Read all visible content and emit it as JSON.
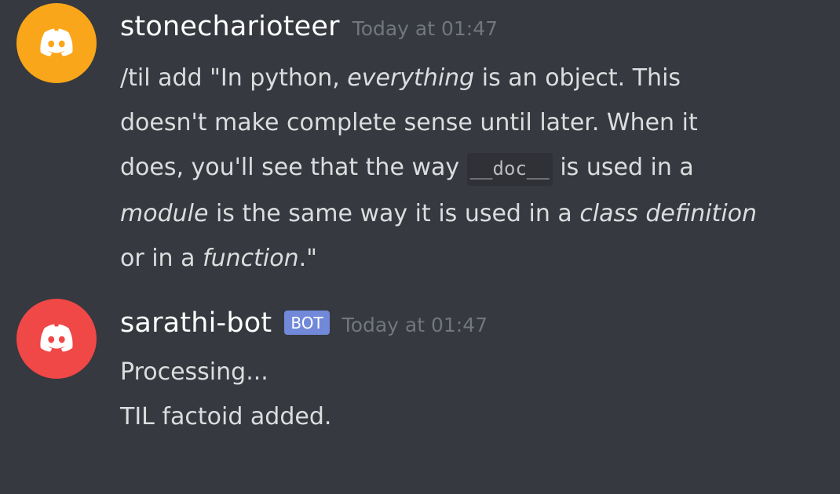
{
  "messages": [
    {
      "username": "stonecharioteer",
      "timestamp": "Today at 01:47",
      "avatar_color": "#faa61a",
      "avatar_icon": "discord-logo-icon",
      "content": {
        "l1_a": "/til add \"In python, ",
        "l1_em": "everything",
        "l1_b": " is an object. This",
        "l2": "doesn't make complete sense until later. When it",
        "l3_a": "does, you'll see that the way ",
        "l3_code": "__doc__",
        "l3_b": " is used in a",
        "l4_em1": "module",
        "l4_a": " is the same way it is used in a ",
        "l4_em2": "class definition",
        "l5_a": "or in a ",
        "l5_em": "function",
        "l5_b": ".\""
      }
    },
    {
      "username": "sarathi-bot",
      "bot_tag": "BOT",
      "timestamp": "Today at 01:47",
      "avatar_color": "#f04747",
      "avatar_icon": "discord-logo-icon",
      "lines": [
        "Processing...",
        "TIL factoid added."
      ]
    }
  ],
  "colors": {
    "background": "#36393f",
    "username": "#ffffff",
    "timestamp": "#72767d",
    "text": "#dcddde",
    "bot_tag": "#7289da"
  }
}
